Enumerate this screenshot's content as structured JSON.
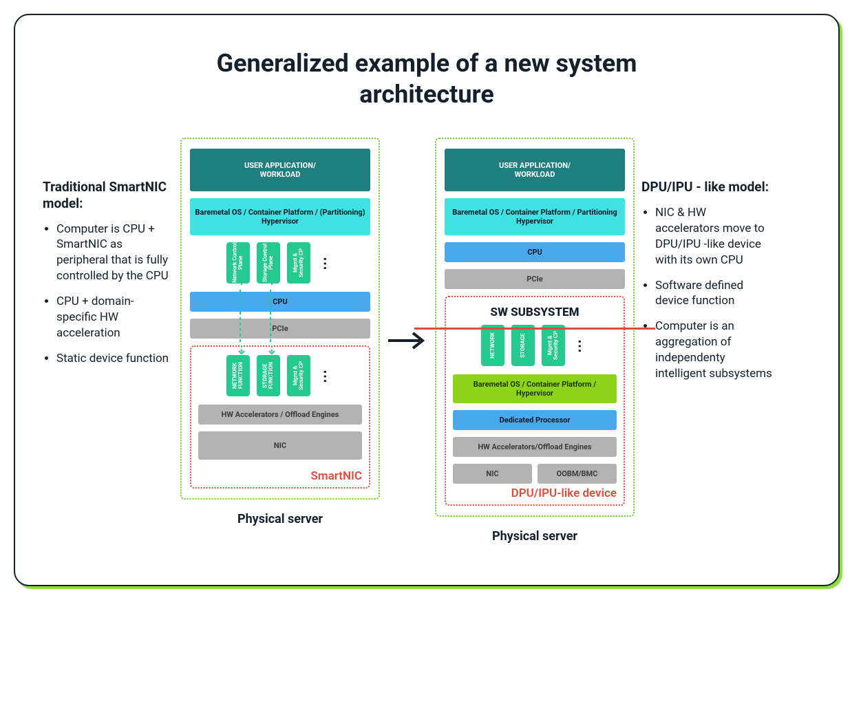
{
  "title": "Generalized example of a new system architecture",
  "left_side": {
    "heading": "Traditional SmartNIC model:",
    "bullets": [
      "Computer is CPU + SmartNIC as peripheral that is fully controlled by the CPU",
      "CPU + domain-specific HW acceleration",
      "Static device function"
    ]
  },
  "right_side": {
    "heading": "DPU/IPU - like model:",
    "bullets": [
      "NIC & HW accelerators move to DPU/IPU -like device with its own CPU",
      "Software defined device function",
      "Computer is an aggregation of independenty intelligent subsystems"
    ]
  },
  "server_left": {
    "caption": "Physical server",
    "user_app": "USER APPLICATION/\nWORKLOAD",
    "os": "Baremetal OS / Container Platform / (Partitioning) Hypervisor",
    "cp_pills": [
      "Network Control Plane",
      "Storage Control Plane",
      "Mgmt & Security CP"
    ],
    "cpu": "CPU",
    "pcie": "PCIe",
    "sub": {
      "label": "SmartNIC",
      "fn_pills": [
        "NETWORK FUNCTION",
        "STORAGE FUNCTION",
        "Mgmt & Security CP"
      ],
      "accel": "HW Accelerators / Offload Engines",
      "nic": "NIC"
    }
  },
  "server_right": {
    "caption": "Physical server",
    "user_app": "USER APPLICATION/\nWORKLOAD",
    "os": "Baremetal OS / Container Platform / Partitioning Hypervisor",
    "cpu": "CPU",
    "pcie": "PCIe",
    "sub": {
      "label": "DPU/IPU-like device",
      "title": "SW SUBSYSTEM",
      "pills": [
        "NETWORK",
        "STORAGE",
        "Mgmt & Security CP"
      ],
      "os": "Baremetal OS / Container Platform / Hypervisor",
      "proc": "Dedicated Processor",
      "accel": "HW Accelerators/Offload Engines",
      "nic": "NIC",
      "bmc": "OOBM/BMC"
    }
  }
}
